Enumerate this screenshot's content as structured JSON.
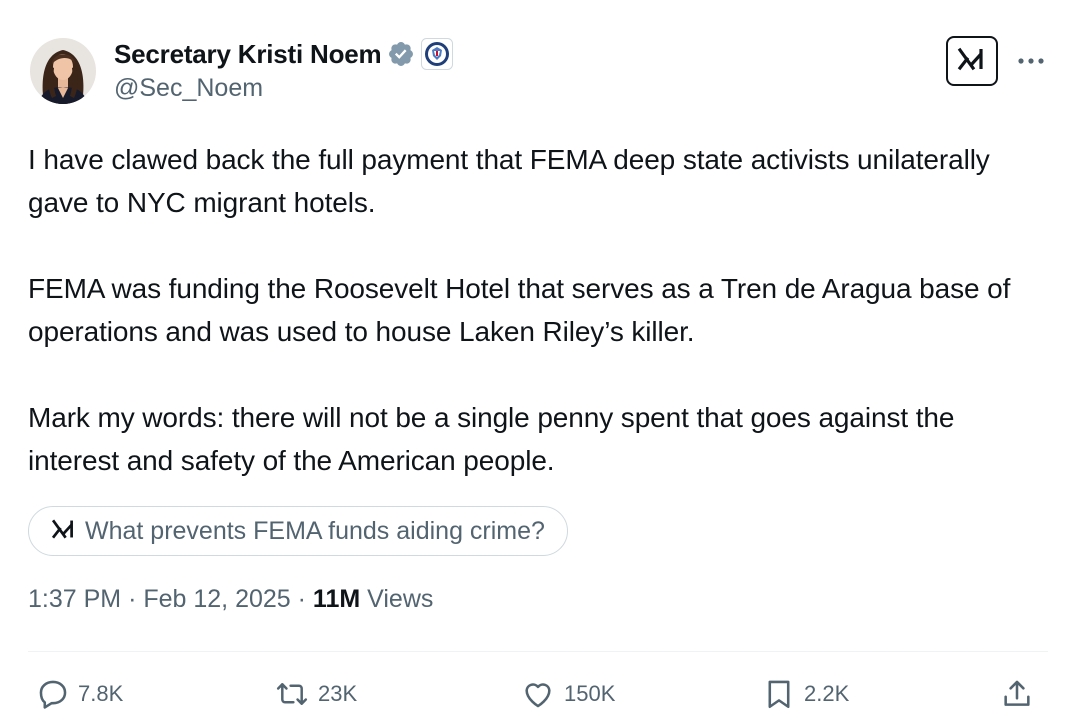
{
  "author": {
    "display_name": "Secretary Kristi Noem",
    "handle": "@Sec_Noem",
    "verified_badge": "verified-badge-icon",
    "affiliation_badge": "dhs-seal-icon"
  },
  "header_actions": {
    "grok_icon": "grok-icon",
    "more_icon": "more-horizontal-icon"
  },
  "tweet": {
    "paragraphs": [
      "I have clawed back the full payment that FEMA deep state activists unilaterally gave to NYC migrant hotels.",
      "FEMA was funding the Roosevelt Hotel that serves as a Tren de Aragua base of operations and was used to house Laken Riley’s killer.",
      "Mark my words: there will not be a single penny spent that goes against the interest and safety of the American people."
    ]
  },
  "grok_prompt": {
    "label": "What prevents FEMA funds aiding crime?",
    "icon": "grok-icon"
  },
  "meta": {
    "time": "1:37 PM",
    "separator": "·",
    "date": "Feb 12, 2025",
    "views_count": "11M",
    "views_label": "Views"
  },
  "actions": {
    "replies": "7.8K",
    "reposts": "23K",
    "likes": "150K",
    "bookmarks": "2.2K"
  },
  "colors": {
    "text_primary": "#0f1419",
    "text_secondary": "#536471",
    "verified_badge": "#829aab",
    "border": "#cfd9de",
    "divider": "#eff3f4"
  }
}
